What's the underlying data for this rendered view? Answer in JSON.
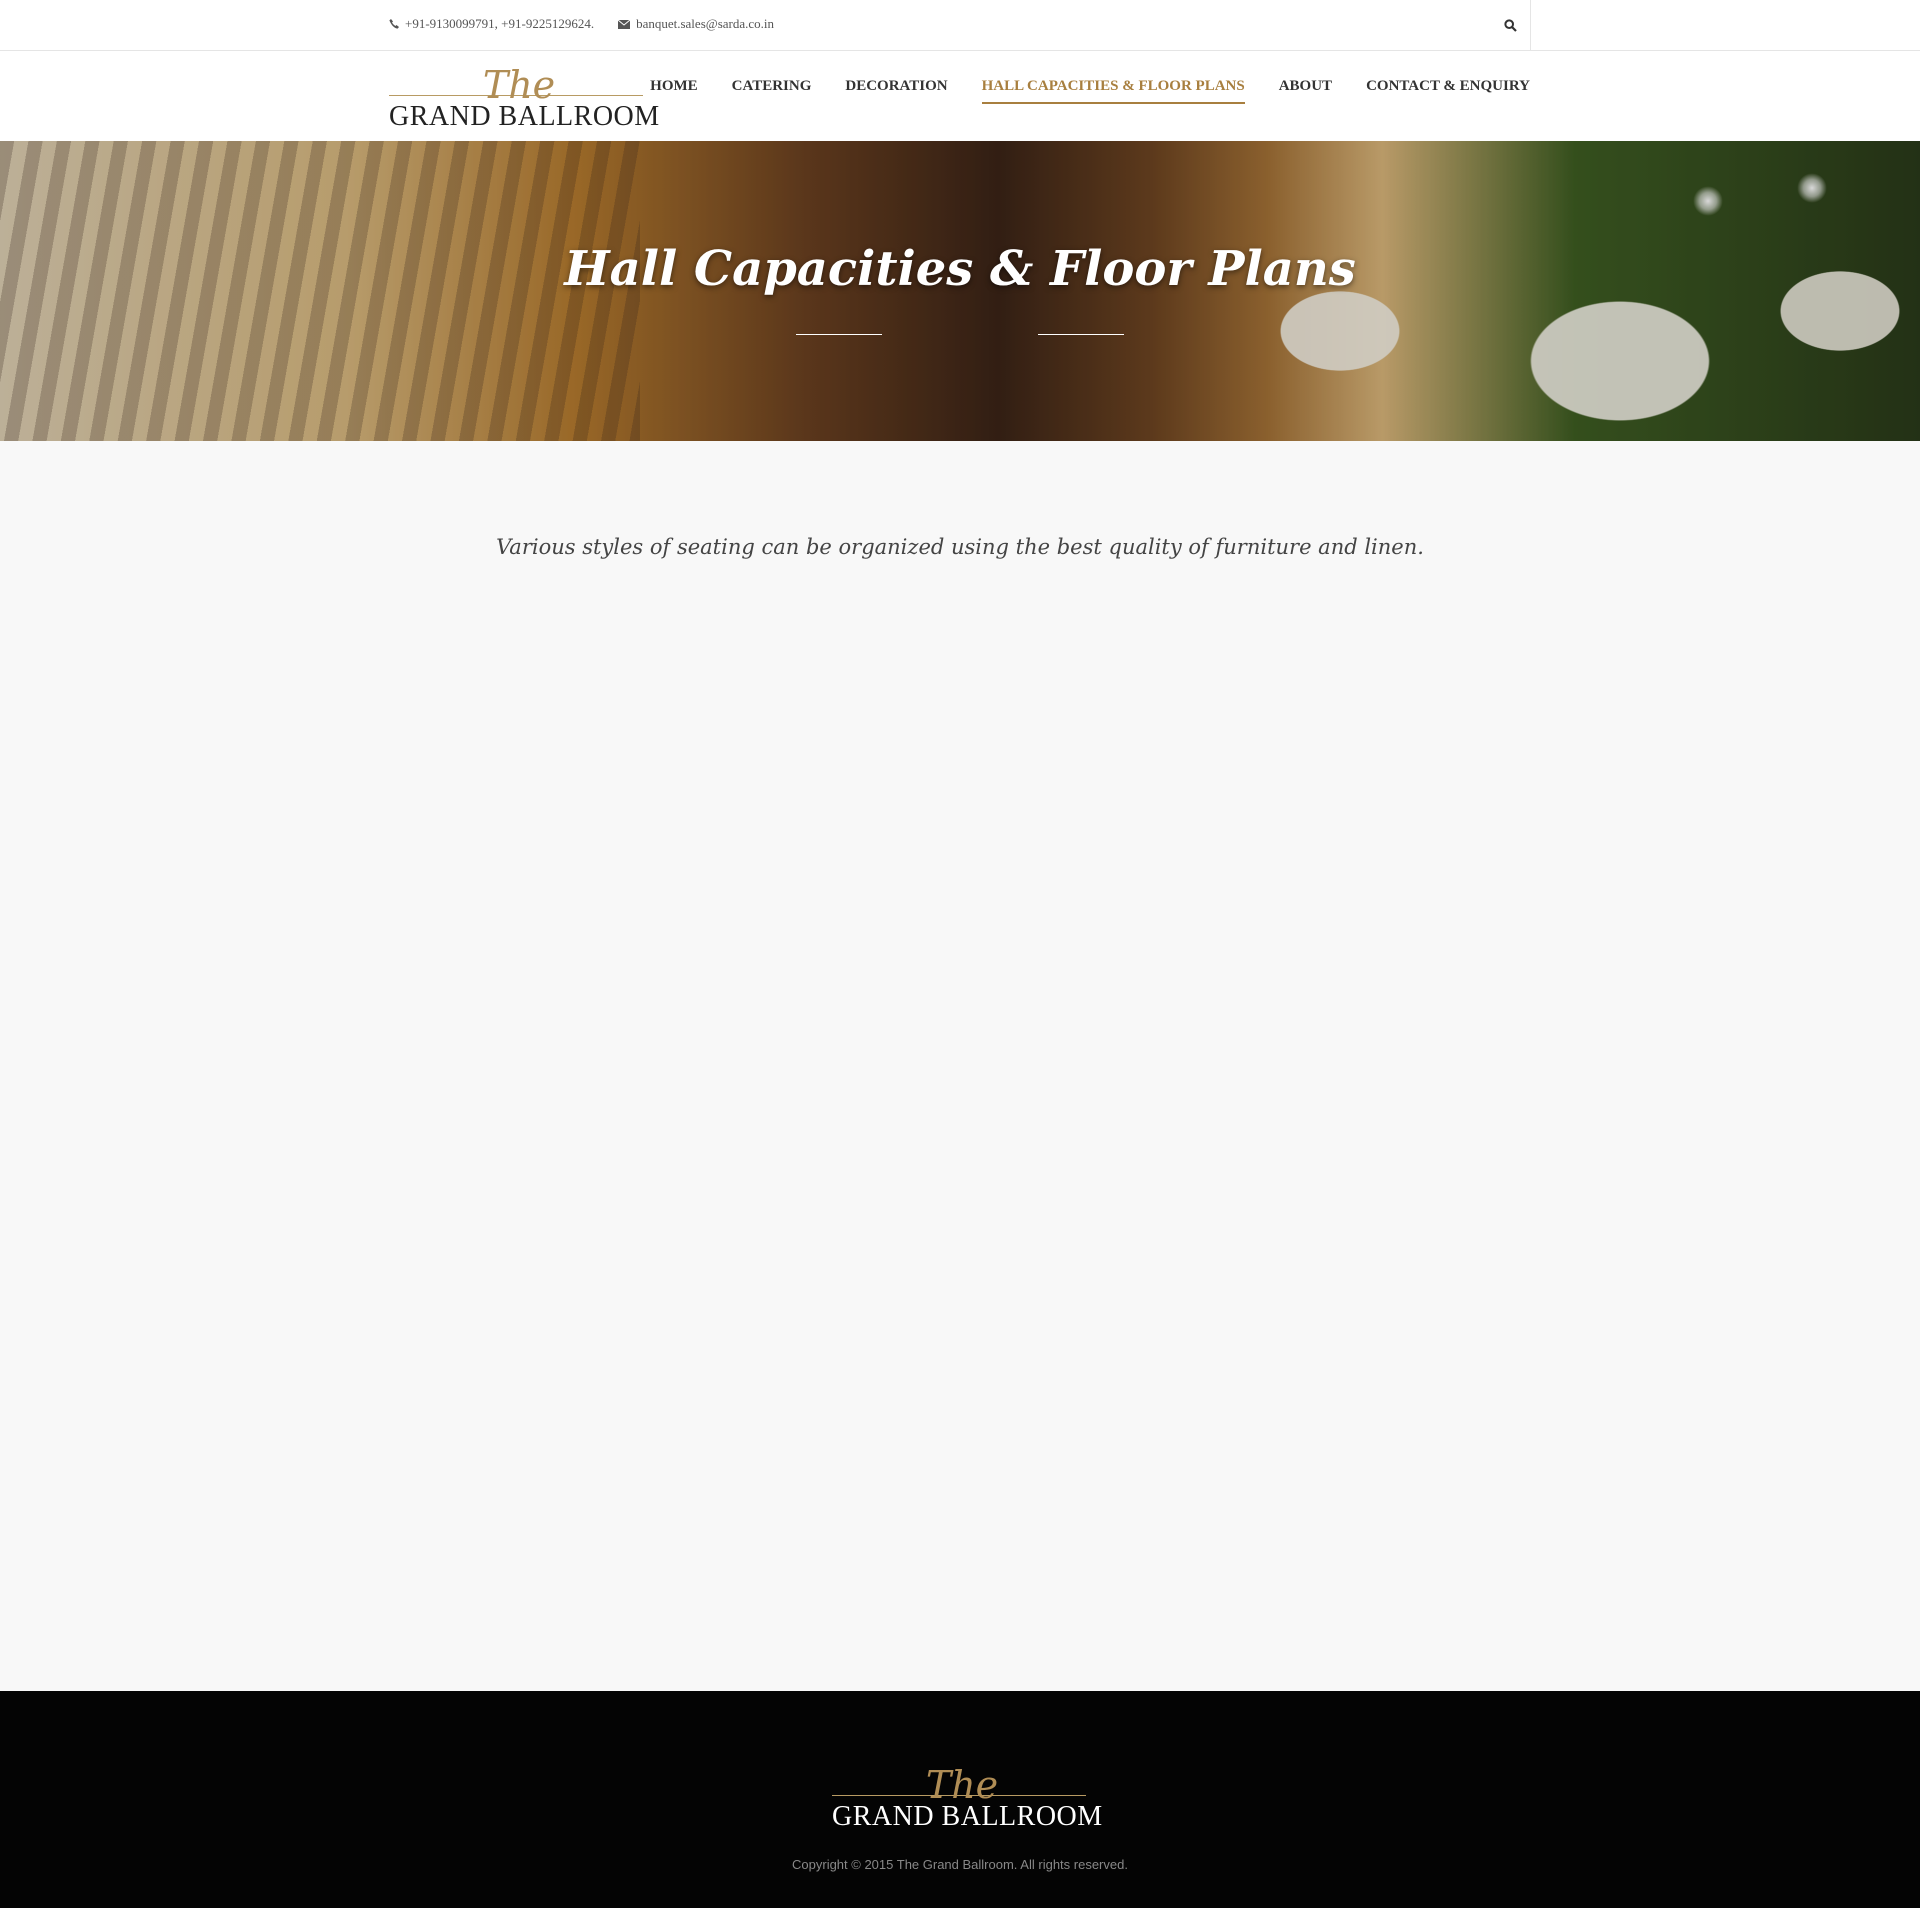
{
  "topbar": {
    "phone": "+91-9130099791, +91-9225129624.",
    "email": "banquet.sales@sarda.co.in",
    "phone_icon": "phone-icon",
    "email_icon": "envelope-icon",
    "search_icon": "search-icon"
  },
  "logo": {
    "the": "The",
    "name": "GRAND BALLROOM"
  },
  "nav": {
    "items": [
      {
        "label": "HOME"
      },
      {
        "label": "CATERING"
      },
      {
        "label": "DECORATION"
      },
      {
        "label": "HALL CAPACITIES & FLOOR PLANS",
        "active": true
      },
      {
        "label": "ABOUT"
      },
      {
        "label": "CONTACT & ENQUIRY"
      }
    ]
  },
  "hero": {
    "title": "Hall Capacities & Floor Plans"
  },
  "intro": {
    "text": "Various styles of seating can be organized using the best quality of furniture and linen."
  },
  "footer": {
    "logo_the": "The",
    "logo_name": "GRAND BALLROOM",
    "copyright": "Copyright © 2015 The Grand Ballroom. All rights reserved."
  },
  "colors": {
    "accent": "#a87f3f",
    "footer_bg": "#040404",
    "page_bg": "#f8f8f8"
  }
}
